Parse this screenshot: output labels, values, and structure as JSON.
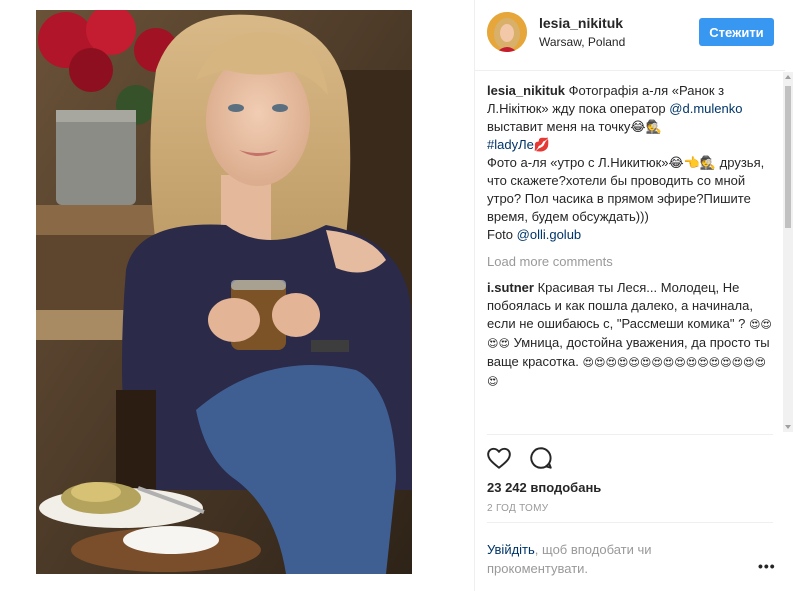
{
  "post": {
    "author": "lesia_nikituk",
    "location": "Warsaw, Poland",
    "follow_label": "Стежити",
    "caption": {
      "username": "lesia_nikituk",
      "text_1": "Фотографія а-ля «Ранок з Л.Нікітюк» жду пока оператор",
      "mention_1": "@d.mulenko",
      "text_2": "выставит меня на точку😂🕵",
      "hashtag": "#ladyЛе💋",
      "text_3": "Фото а-ля «утро с Л.Никитюк»😂👈🕵 друзья, что скажете?хотели бы проводить со мной утро? Пол часика в прямом эфире?Пишите время, будем обсуждать)))",
      "photo_prefix": "Foto",
      "mention_2": "@olli.golub"
    },
    "load_more": "Load more comments",
    "comments": [
      {
        "username": "i.sutner",
        "text_1": "Красивая ты Леся... Молодец, Не побоялась и как пошла далеко, а начинала, если не ошибаюсь с, \"Рассмеши комика\" ?",
        "emoji_1": "😍😍😍😍",
        "text_2": "Умница, достойна уважения, да просто ты ваще красотка.",
        "emoji_2": "😍😍😍😍😍😍😍😍😍😍😍😍😍😍😍😍😍"
      }
    ],
    "likes": "23 242 вподобань",
    "time_ago": "2 ГОД ТОМУ",
    "login_link": "Увійдіть",
    "login_text": ", щоб вподобати чи прокоментувати.",
    "more_options": "•••",
    "icons": {
      "like": "heart-icon",
      "comment": "comment-icon",
      "more": "more-options-icon"
    },
    "colors": {
      "accent": "#3897f0",
      "link": "#003569",
      "muted": "#999999"
    }
  }
}
